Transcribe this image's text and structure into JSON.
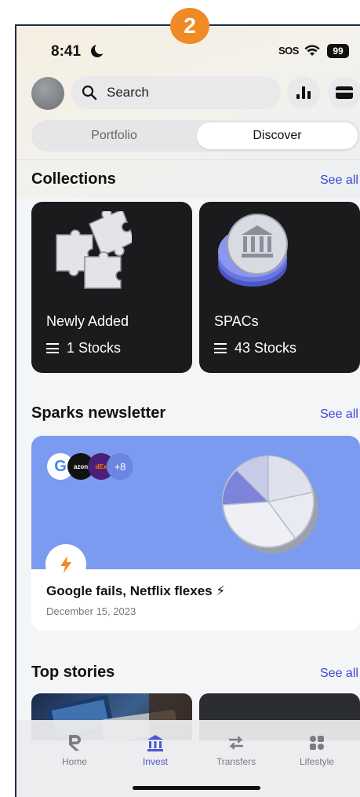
{
  "overlay": {
    "step_number": "2"
  },
  "status_bar": {
    "time": "8:41",
    "sos": "SOS",
    "battery": "99"
  },
  "header": {
    "search_placeholder": "Search"
  },
  "segmented": {
    "portfolio": "Portfolio",
    "discover": "Discover",
    "active": "Discover"
  },
  "collections": {
    "title": "Collections",
    "see_all": "See all",
    "items": [
      {
        "name": "Newly Added",
        "count": "1 Stocks",
        "icon": "puzzle-icon"
      },
      {
        "name": "SPACs",
        "count": "43 Stocks",
        "icon": "bank-coin-icon"
      }
    ]
  },
  "newsletter": {
    "title": "Sparks newsletter",
    "see_all": "See all",
    "logos": [
      "G",
      "azon",
      "dEx",
      "+8"
    ],
    "headline": "Google fails, Netflix flexes ⚡",
    "date": "December 15, 2023"
  },
  "top_stories": {
    "title": "Top stories",
    "see_all": "See all"
  },
  "tab_bar": {
    "items": [
      {
        "label": "Home",
        "icon": "r-logo-icon"
      },
      {
        "label": "Invest",
        "icon": "bank-icon"
      },
      {
        "label": "Transfers",
        "icon": "arrows-icon"
      },
      {
        "label": "Lifestyle",
        "icon": "grid-icon"
      }
    ],
    "active": "Invest"
  },
  "colors": {
    "accent": "#3b46d4",
    "card_dark": "#1b1b1d",
    "newsletter_bg": "#7a9bf0",
    "badge": "#f08a24"
  }
}
